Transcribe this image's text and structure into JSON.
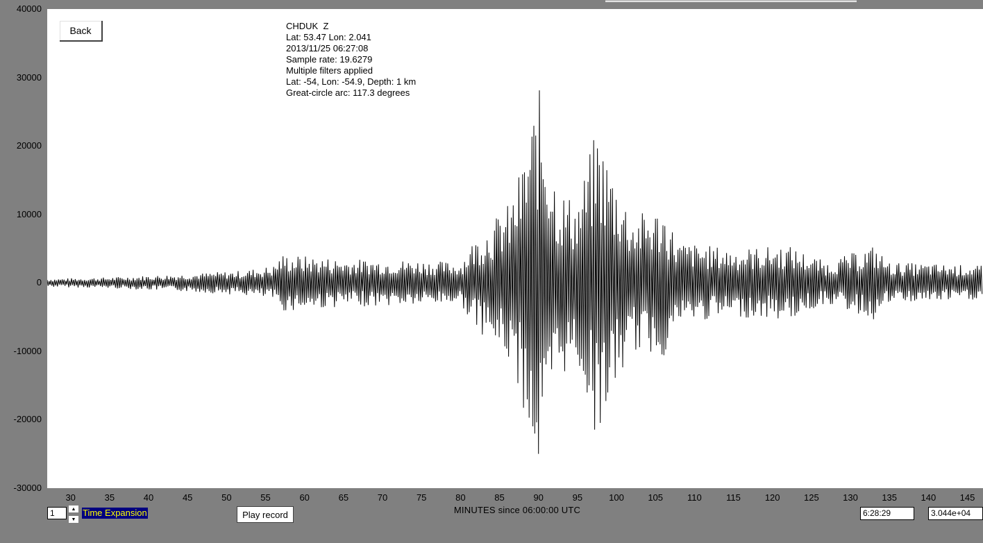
{
  "back_label": "Back",
  "info_lines": [
    "CHDUK  Z",
    "Lat: 53.47 Lon: 2.041",
    "2013/11/25 06:27:08",
    "Sample rate: 19.6279",
    "Multiple filters applied",
    "Lat: -54, Lon: -54.9, Depth: 1 km",
    "Great-circle arc: 117.3 degrees"
  ],
  "chart_data": {
    "type": "line",
    "xlabel": "MINUTES since 06:00:00 UTC",
    "ylabel": "",
    "xlim": [
      27.0,
      147.0
    ],
    "ylim": [
      -30000,
      40000
    ],
    "x_ticks": [
      "30",
      "35",
      "40",
      "45",
      "50",
      "55",
      "60",
      "65",
      "70",
      "75",
      "80",
      "85",
      "90",
      "95",
      "100",
      "105",
      "110",
      "115",
      "120",
      "125",
      "130",
      "135",
      "140",
      "145"
    ],
    "y_ticks": [
      "40000",
      "30000",
      "20000",
      "10000",
      "0",
      "-10000",
      "-20000",
      "-30000"
    ],
    "line_color": "#000000",
    "background": "#ffffff",
    "envelope": [
      {
        "x": 27,
        "a": 600
      },
      {
        "x": 35,
        "a": 800
      },
      {
        "x": 45,
        "a": 1300
      },
      {
        "x": 52,
        "a": 1800
      },
      {
        "x": 56,
        "a": 2500
      },
      {
        "x": 57,
        "a": 4200
      },
      {
        "x": 65,
        "a": 3500
      },
      {
        "x": 75,
        "a": 3300
      },
      {
        "x": 80,
        "a": 3000
      },
      {
        "x": 81.5,
        "a": 6000
      },
      {
        "x": 84,
        "a": 9000
      },
      {
        "x": 86.5,
        "a": 12000
      },
      {
        "x": 88,
        "a": 18000
      },
      {
        "x": 90,
        "a": 29000
      },
      {
        "x": 92.5,
        "a": 14000
      },
      {
        "x": 95,
        "a": 12000
      },
      {
        "x": 97.5,
        "a": 23000
      },
      {
        "x": 99,
        "a": 18000
      },
      {
        "x": 102,
        "a": 10000
      },
      {
        "x": 106,
        "a": 11000
      },
      {
        "x": 108,
        "a": 6000
      },
      {
        "x": 115,
        "a": 5000
      },
      {
        "x": 122,
        "a": 5500
      },
      {
        "x": 127,
        "a": 3000
      },
      {
        "x": 133,
        "a": 5500
      },
      {
        "x": 135,
        "a": 3000
      },
      {
        "x": 147,
        "a": 2500
      }
    ],
    "sample_step_min": 0.12
  },
  "controls": {
    "time_expansion_value": "1",
    "time_expansion_label": "Time Expansion",
    "play_label": "Play record",
    "time_readout": "6:28:29",
    "value_readout": "3.044e+04"
  }
}
